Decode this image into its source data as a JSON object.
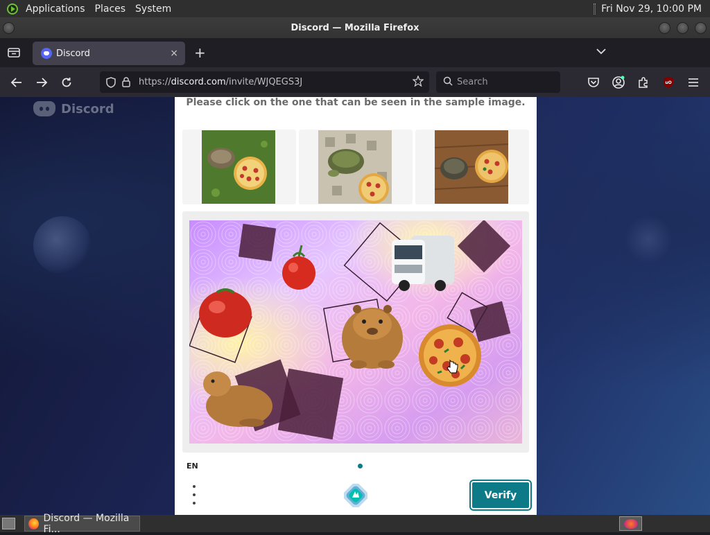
{
  "top_panel": {
    "menus": [
      "Applications",
      "Places",
      "System"
    ],
    "clock": "Fri Nov 29, 10:00 PM"
  },
  "window": {
    "title": "Discord — Mozilla Firefox"
  },
  "browser": {
    "tab": {
      "title": "Discord",
      "close_icon": "×"
    },
    "new_tab_icon": "+",
    "url_prefix": "https://",
    "url_host": "discord.com",
    "url_path": "/invite/WJQEGS3J",
    "search_placeholder": "Search"
  },
  "page": {
    "brand": "Discord",
    "captcha": {
      "prompt": "Please click on the one that can be seen in the sample image.",
      "samples": [
        {
          "description": "tortoise-and-pizza-on-grass"
        },
        {
          "description": "tortoise-and-pizza-on-tiles"
        },
        {
          "description": "tortoise-and-pizza-on-wood"
        }
      ],
      "language": "EN",
      "verify_label": "Verify"
    }
  },
  "taskbar": {
    "task_label": "Discord — Mozilla Fi..."
  },
  "colors": {
    "accent": "#0c7a87",
    "discord_blurple": "#5865f2",
    "panel": "#2f2f2f"
  }
}
